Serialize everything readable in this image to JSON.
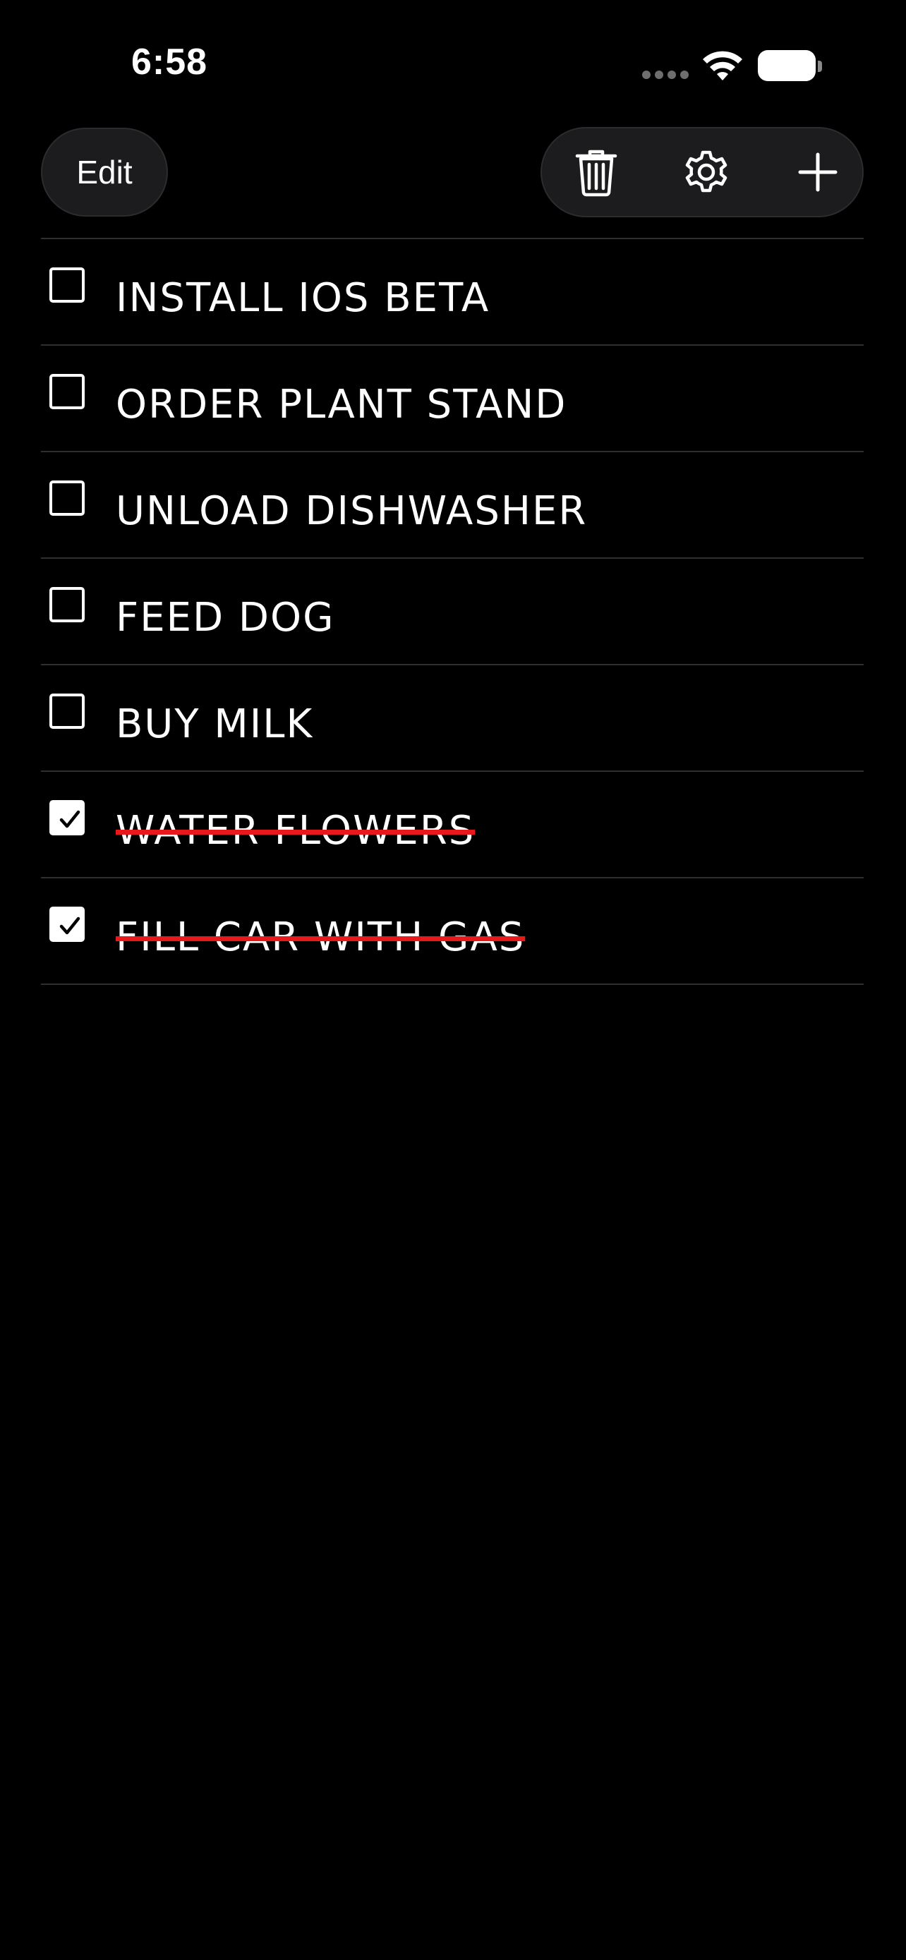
{
  "status_bar": {
    "time": "6:58",
    "icons": [
      "signal-dots-icon",
      "wifi-icon",
      "battery-icon"
    ]
  },
  "toolbar": {
    "edit_label": "Edit",
    "actions": [
      "trash-icon",
      "gear-icon",
      "plus-icon"
    ]
  },
  "todos": [
    {
      "label": "INSTALL IOS BETA",
      "done": false
    },
    {
      "label": "ORDER PLANT STAND",
      "done": false
    },
    {
      "label": "UNLOAD DISHWASHER",
      "done": false
    },
    {
      "label": "FEED DOG",
      "done": false
    },
    {
      "label": "BUY MILK",
      "done": false
    },
    {
      "label": "WATER FLOWERS",
      "done": true
    },
    {
      "label": "FILL CAR WITH GAS",
      "done": true
    }
  ],
  "colors": {
    "background": "#000000",
    "text": "#ffffff",
    "strikethrough": "#e8191b",
    "button_bg": "#1c1c1e",
    "divider": "#2e2e2e"
  }
}
